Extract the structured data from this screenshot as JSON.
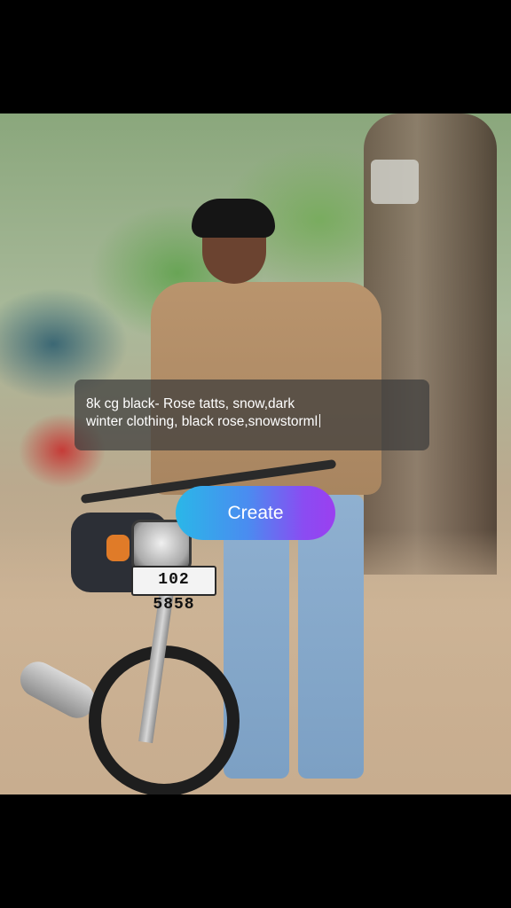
{
  "prompt": {
    "text": "8k cg black- Rose tatts, snow,dark\nwinter clothing, black rose,snowstorml"
  },
  "create_button": {
    "label": "Create"
  },
  "photo": {
    "license_plate": "102 5858"
  },
  "colors": {
    "background": "#000000",
    "prompt_overlay": "rgba(60,60,60,0.72)",
    "button_gradient_start": "#2ab7e8",
    "button_gradient_end": "#9b3ff0",
    "text": "#ffffff"
  }
}
